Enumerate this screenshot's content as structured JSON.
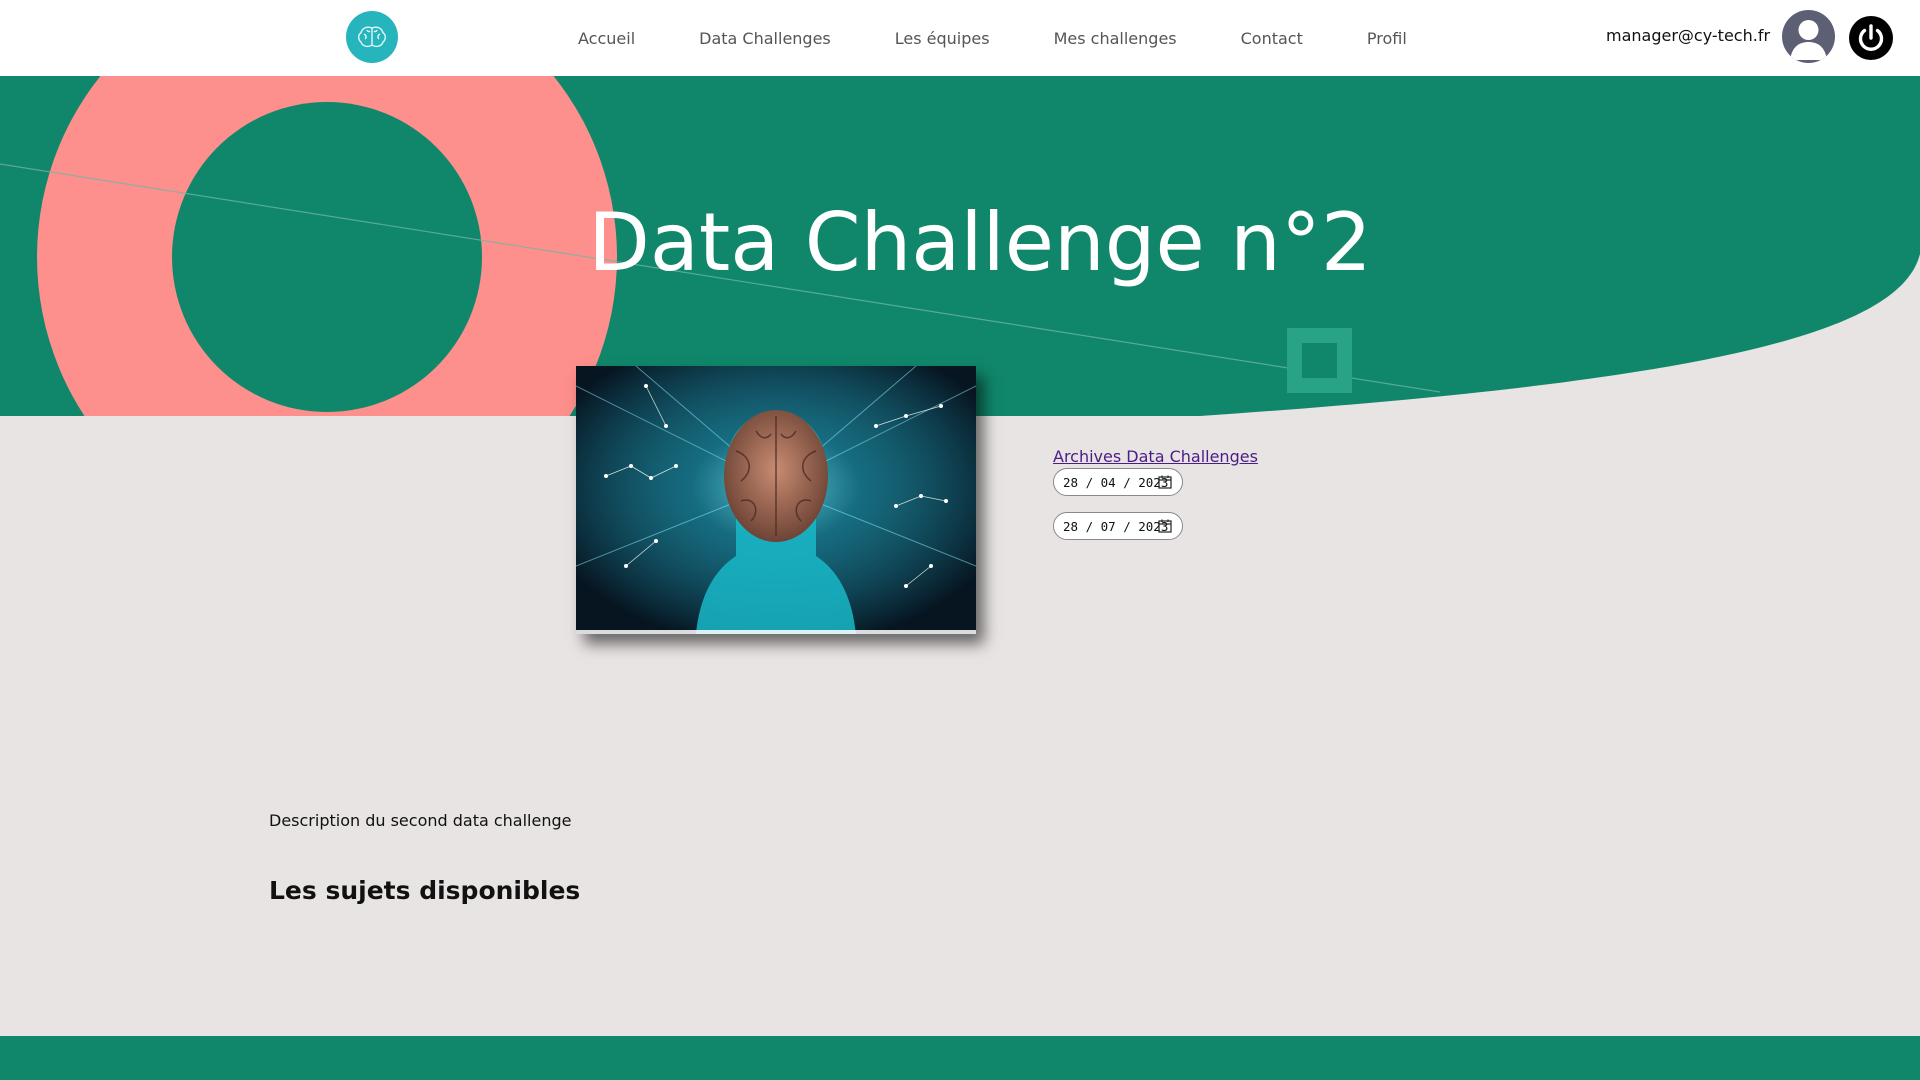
{
  "header": {
    "nav": [
      "Accueil",
      "Data Challenges",
      "Les équipes",
      "Mes challenges",
      "Contact",
      "Profil"
    ],
    "user_email": "manager@cy-tech.fr"
  },
  "hero": {
    "title": "Data Challenge n°2"
  },
  "sidebar": {
    "archives_link": "Archives Data Challenges",
    "start_date": "28 / 04 / 2023",
    "end_date": "28 / 07 / 2023"
  },
  "content": {
    "description": "Description du second data challenge",
    "subjects_heading": "Les sujets disponibles"
  },
  "colors": {
    "primary_green": "#10876a",
    "coral": "#fd8f8c",
    "logo_teal": "#26b5bd",
    "background": "#e8e4e3",
    "link_purple": "#4b1d86"
  },
  "icons": {
    "logo": "brain-icon",
    "avatar": "user-avatar-icon",
    "logout": "power-icon",
    "date_picker": "calendar-icon"
  }
}
